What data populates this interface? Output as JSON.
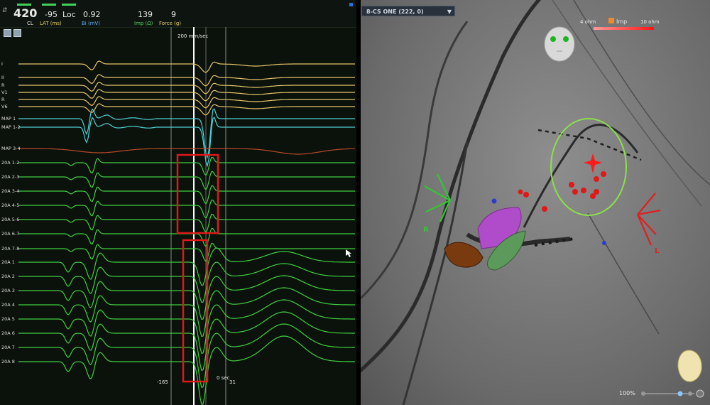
{
  "header": {
    "cl_value": "420",
    "cl_label": "CL",
    "lat_value": "-95",
    "lat_label": "LAT (ms)",
    "loc_label": "Loc",
    "bi_value": "0.92",
    "bi_label": "Bi (mV)",
    "imp_value": "139",
    "imp_label": "Imp (Ω)",
    "force_value": "9",
    "force_label": "Force (g)"
  },
  "ecg": {
    "scale_label": "200 mm/sec",
    "left_marker": "-165",
    "right_marker": "31",
    "time_label": "0 sec",
    "channels": [
      "I",
      "II",
      "R",
      "V1",
      "R",
      "V6",
      "MAP 1",
      "MAP 1-2",
      "MAP 3-4",
      "20A 1-2",
      "20A 2-3",
      "20A 3-4",
      "20A 4-5",
      "20A 5-6",
      "20A 6-7",
      "20A 7-8",
      "20A 1",
      "20A 2",
      "20A 3",
      "20A 4",
      "20A 5",
      "20A 6",
      "20A 7",
      "20A 8"
    ]
  },
  "map": {
    "view_selector": "8-CS ONE (222, 0)",
    "imp_legend_label": "Imp",
    "imp_min": "4 ohm",
    "imp_max": "10 ohm",
    "right_label": "R",
    "left_label": "L",
    "zoom": "100%",
    "colors": {
      "right_axis": "#35c535",
      "left_axis": "#dd2020",
      "target": "#8be04a"
    }
  }
}
